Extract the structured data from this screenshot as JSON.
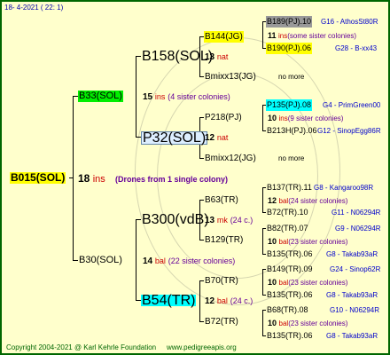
{
  "header": "18-  4-2021 ( 22:  1)",
  "footer": {
    "copyright": "Copyright 2004-2021 @ Karl Kehrle Foundation",
    "site": "www.pedigreeapis.org"
  },
  "colors": {
    "bg": "#ffffcc",
    "line": "#000000",
    "green": "#00ee00",
    "yellow": "#ffff00",
    "grey": "#999999",
    "cyan": "#00ffff",
    "red": "#cc0000",
    "purple": "#660099",
    "blue": "#0000cc"
  },
  "root": {
    "name": "B015(SOL)",
    "num": "18",
    "unit": "ins",
    "note": "(Drones from 1 single colony)"
  },
  "gen1": [
    {
      "name": "B33(SOL)",
      "num": "15",
      "unit": "ins",
      "note": "(4 sister colonies)"
    },
    {
      "name": "B30(SOL)",
      "num": "14",
      "unit": "bal",
      "note": "(22 sister colonies)"
    }
  ],
  "gen2": [
    {
      "name": "B158(SOL)",
      "num": "13",
      "unit": "nat"
    },
    {
      "name": "P32(SOL)",
      "num": "12",
      "unit": "nat"
    },
    {
      "name": "B300(vdB)",
      "num": "13",
      "unit": "mk",
      "note": "(24 c.)"
    },
    {
      "name": "B54(TR)",
      "num": "12",
      "unit": "bal",
      "note": "(24 c.)"
    }
  ],
  "gen3": [
    {
      "name": "B144(JG)",
      "num": "13",
      "unit": "nat"
    },
    {
      "name": "Bmixx13(JG)",
      "extra": "no more"
    },
    {
      "name": "P218(PJ)",
      "num": "12",
      "unit": "nat"
    },
    {
      "name": "Bmixx12(JG)",
      "extra": "no more"
    },
    {
      "name": "B63(TR)",
      "num": "",
      "unit": ""
    },
    {
      "name": "B129(TR)",
      "num": "",
      "unit": ""
    },
    {
      "name": "B70(TR)",
      "num": "",
      "unit": ""
    },
    {
      "name": "B72(TR)",
      "num": "",
      "unit": ""
    }
  ],
  "gen4": [
    {
      "top": "B189(PJ).10",
      "topCode": "G16 - AthosSt80R",
      "mid_num": "11",
      "mid_unit": "ins",
      "mid_note": "(some sister colonies)",
      "bot": "B190(PJ).06",
      "botCode": "G28 - B-xx43"
    },
    {
      "top": "P135(PJ).08",
      "topCode": "G4 - PrimGreen00",
      "mid_num": "10",
      "mid_unit": "ins",
      "mid_note": "(9 sister colonies)",
      "bot": "B213H(PJ).06",
      "botCode": "G12 - SinopEgg86R"
    },
    {
      "top": "B137(TR).11",
      "topCode": "G8 - Kangaroo98R",
      "mid_num": "12",
      "mid_unit": "bal",
      "mid_note": "(24 sister colonies)",
      "bot": "B72(TR).10",
      "botCode": "G11 - N06294R"
    },
    {
      "top": "B82(TR).07",
      "topCode": "G9 - N06294R",
      "mid_num": "10",
      "mid_unit": "bal",
      "mid_note": "(23 sister colonies)",
      "bot": "B135(TR).06",
      "botCode": "G8 - Takab93aR"
    },
    {
      "top": "B149(TR).09",
      "topCode": "G24 - Sinop62R",
      "mid_num": "10",
      "mid_unit": "bal",
      "mid_note": "(23 sister colonies)",
      "bot": "B135(TR).06",
      "botCode": "G8 - Takab93aR"
    },
    {
      "top": "B68(TR).08",
      "topCode": "G10 - N06294R",
      "mid_num": "10",
      "mid_unit": "bal",
      "mid_note": "(23 sister colonies)",
      "bot": "B135(TR).06",
      "botCode": "G8 - Takab93aR"
    }
  ]
}
